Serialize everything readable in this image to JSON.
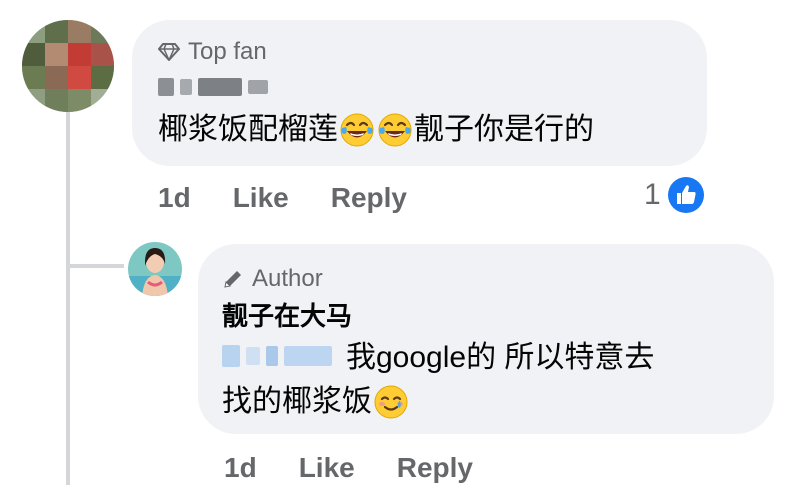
{
  "comment": {
    "badge": "Top fan",
    "text_part1": "椰浆饭配榴莲",
    "text_part2": "靓子你是行的",
    "time": "1d",
    "like_label": "Like",
    "reply_label": "Reply",
    "reaction_count": "1"
  },
  "reply": {
    "badge": "Author",
    "author_name": "靓子在大马",
    "text_part1": "我google的 所以特意去",
    "text_part2": "找的椰浆饭",
    "time": "1d",
    "like_label": "Like",
    "reply_label": "Reply"
  },
  "colors": {
    "bubble": "#f0f2f5",
    "secondary_text": "#65676b",
    "like_blue": "#1877f2",
    "thread_line": "#d4d6d9"
  },
  "icons": {
    "top_fan": "diamond-icon",
    "author": "pencil-icon",
    "reaction": "thumbs-up-icon",
    "emoji_laughing": "tears-of-joy-emoji",
    "emoji_reply": "smiling-with-tear-emoji"
  }
}
